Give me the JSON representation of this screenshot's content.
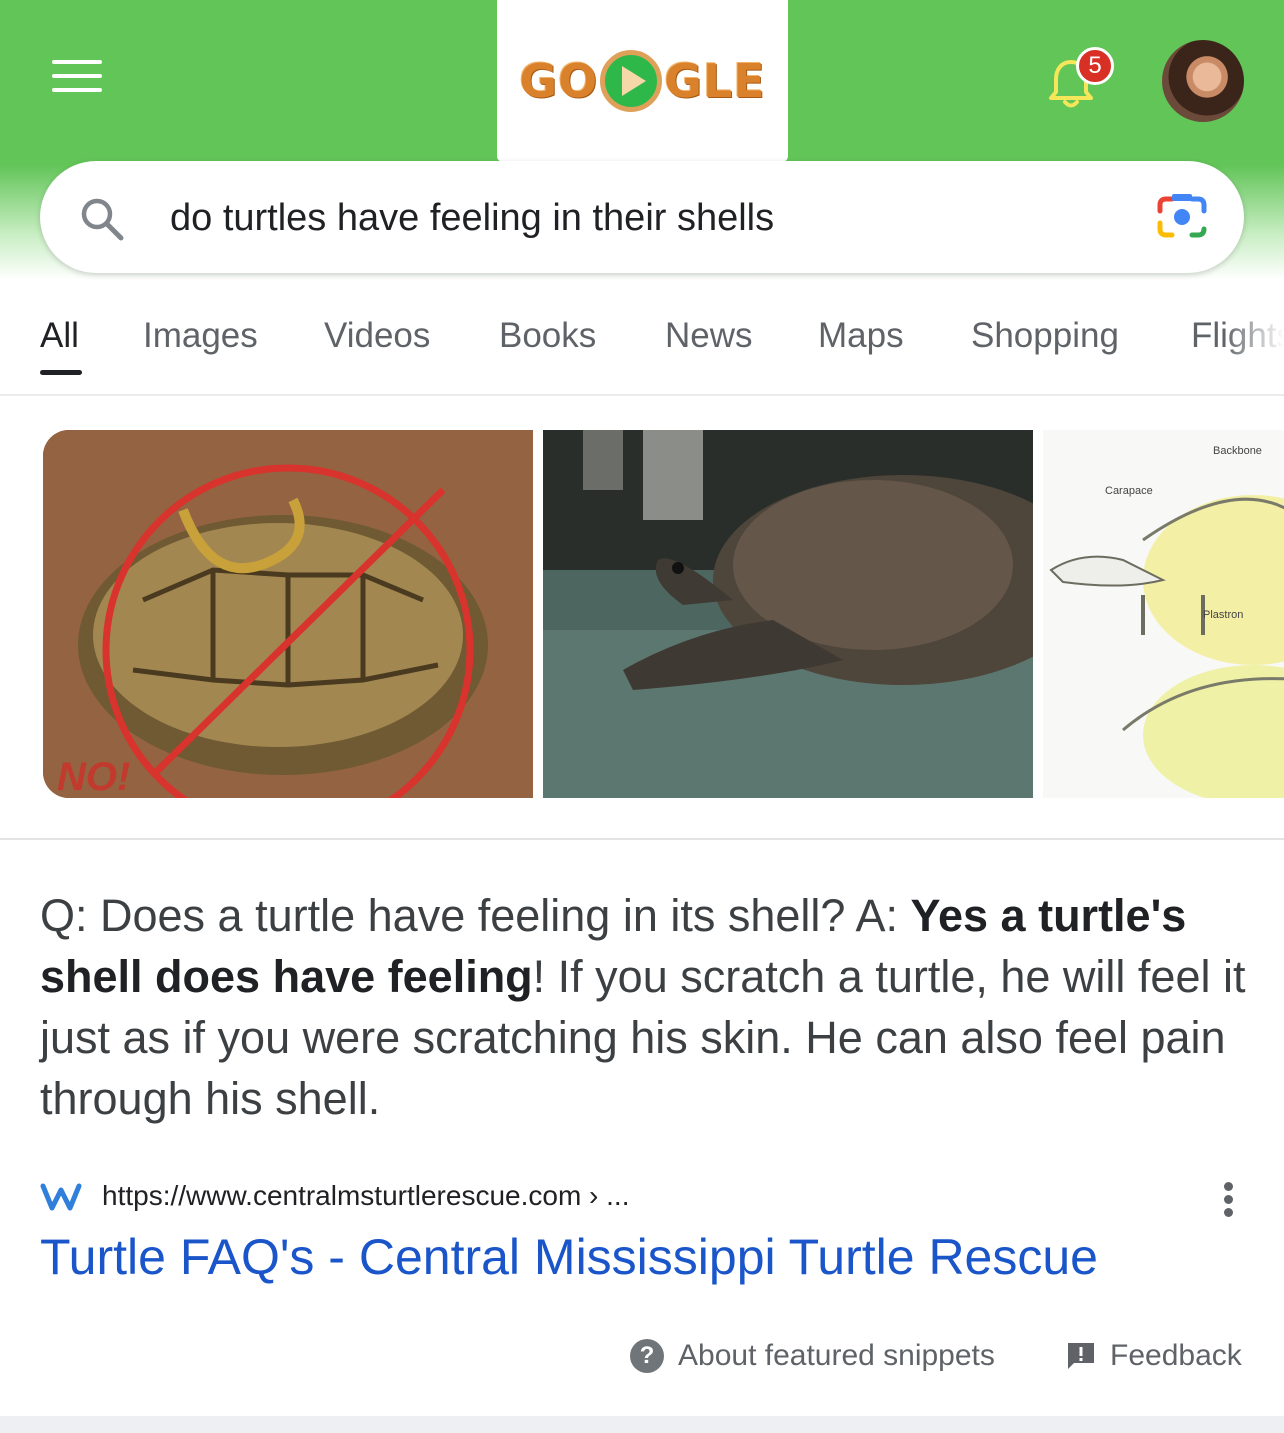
{
  "header": {
    "menu_icon": "hamburger-menu-icon",
    "logo_text_left": "GO",
    "logo_text_right": "GLE",
    "notification_count": "5",
    "colors": {
      "bar": "#62c558",
      "badge": "#d93025"
    }
  },
  "search": {
    "query": "do turtles have feeling in their shells"
  },
  "tabs": [
    {
      "label": "All",
      "active": true
    },
    {
      "label": "Images"
    },
    {
      "label": "Videos"
    },
    {
      "label": "Books"
    },
    {
      "label": "News"
    },
    {
      "label": "Maps"
    },
    {
      "label": "Shopping"
    },
    {
      "label": "Flights"
    }
  ],
  "images": {
    "first_overlay": "NO!",
    "diagram_labels": {
      "backbone": "Backbone",
      "carapace": "Carapace",
      "plastron": "Plastron"
    }
  },
  "snippet": {
    "prefix": "Q: Does a turtle have feeling in its shell? A: ",
    "bold": "Yes a turtle's shell does have feeling",
    "suffix": "! If you scratch a turtle, he will feel it just as if you were scratching his skin. He can also feel pain through his shell."
  },
  "result": {
    "url": "https://www.centralmsturtlerescue.com › ...",
    "title": "Turtle FAQ's - Central Mississippi Turtle Rescue",
    "title_color": "#1a55c9"
  },
  "footer": {
    "about_label": "About featured snippets",
    "feedback_label": "Feedback"
  }
}
